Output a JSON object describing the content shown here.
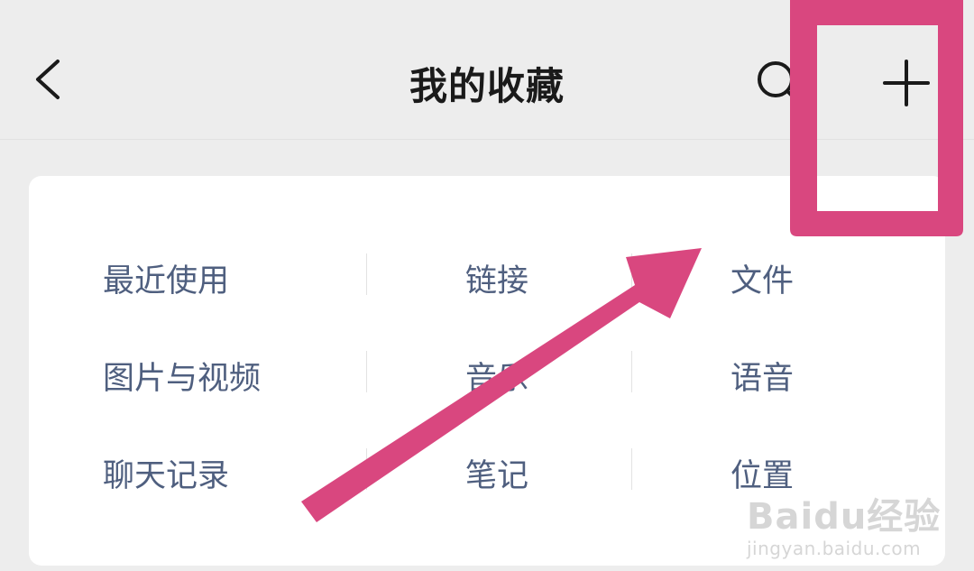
{
  "header": {
    "title": "我的收藏",
    "back_icon": "chevron-left-icon",
    "search_icon": "search-icon",
    "add_icon": "plus-icon"
  },
  "categories": [
    [
      "最近使用",
      "链接",
      "文件"
    ],
    [
      "图片与视频",
      "音乐",
      "语音"
    ],
    [
      "聊天记录",
      "笔记",
      "位置"
    ]
  ],
  "annotation": {
    "highlight_color": "#d9477f",
    "shape": "rectangle-and-arrow"
  },
  "watermark": {
    "brand": "Baidu经验",
    "url": "jingyan.baidu.com"
  }
}
